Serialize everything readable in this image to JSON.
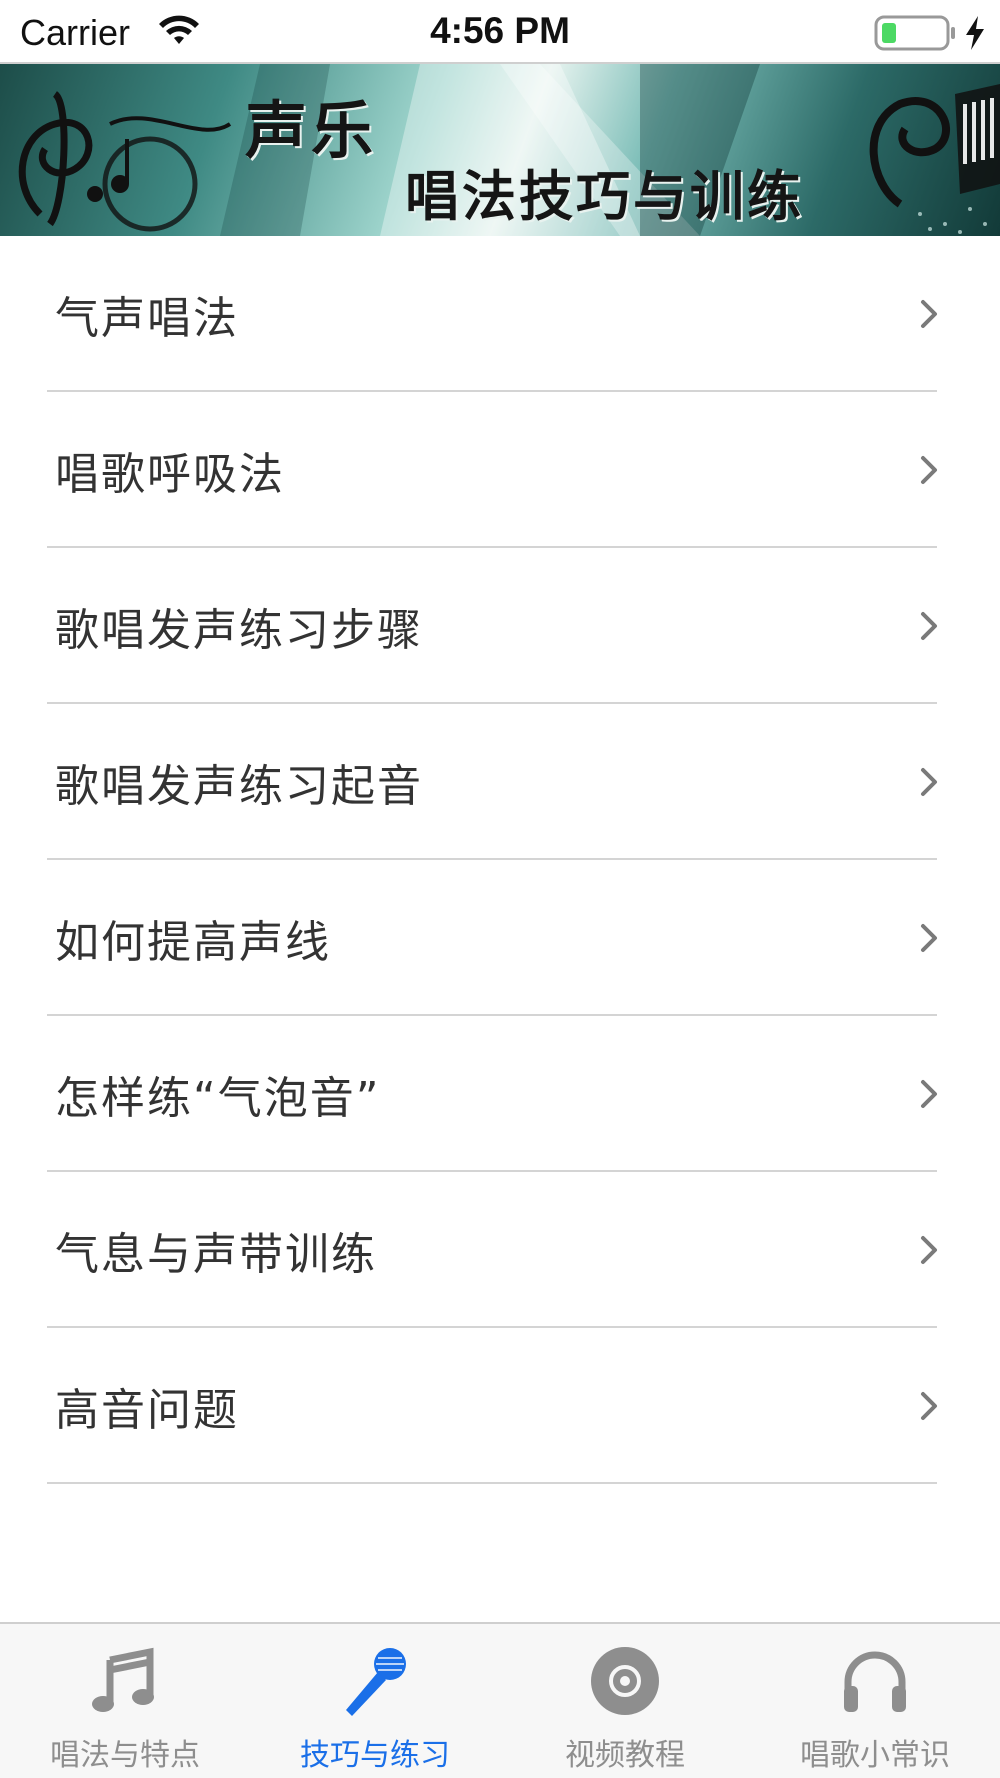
{
  "status_bar": {
    "carrier": "Carrier",
    "time": "4:56 PM"
  },
  "banner": {
    "title_line1": "声乐",
    "title_line2": "唱法技巧与训练"
  },
  "list": {
    "items": [
      {
        "label": "气声唱法"
      },
      {
        "label": "唱歌呼吸法"
      },
      {
        "label": "歌唱发声练习步骤"
      },
      {
        "label": "歌唱发声练习起音"
      },
      {
        "label": "如何提高声线"
      },
      {
        "label": "怎样练“气泡音”"
      },
      {
        "label": "气息与声带训练"
      },
      {
        "label": "高音问题"
      }
    ]
  },
  "tab_bar": {
    "active_color": "#1a6fe8",
    "inactive_color": "#8e8e8e",
    "tabs": [
      {
        "label": "唱法与特点",
        "icon": "music-note-icon",
        "active": false
      },
      {
        "label": "技巧与练习",
        "icon": "microphone-icon",
        "active": true
      },
      {
        "label": "视频教程",
        "icon": "disc-icon",
        "active": false
      },
      {
        "label": "唱歌小常识",
        "icon": "headphones-icon",
        "active": false
      }
    ]
  }
}
